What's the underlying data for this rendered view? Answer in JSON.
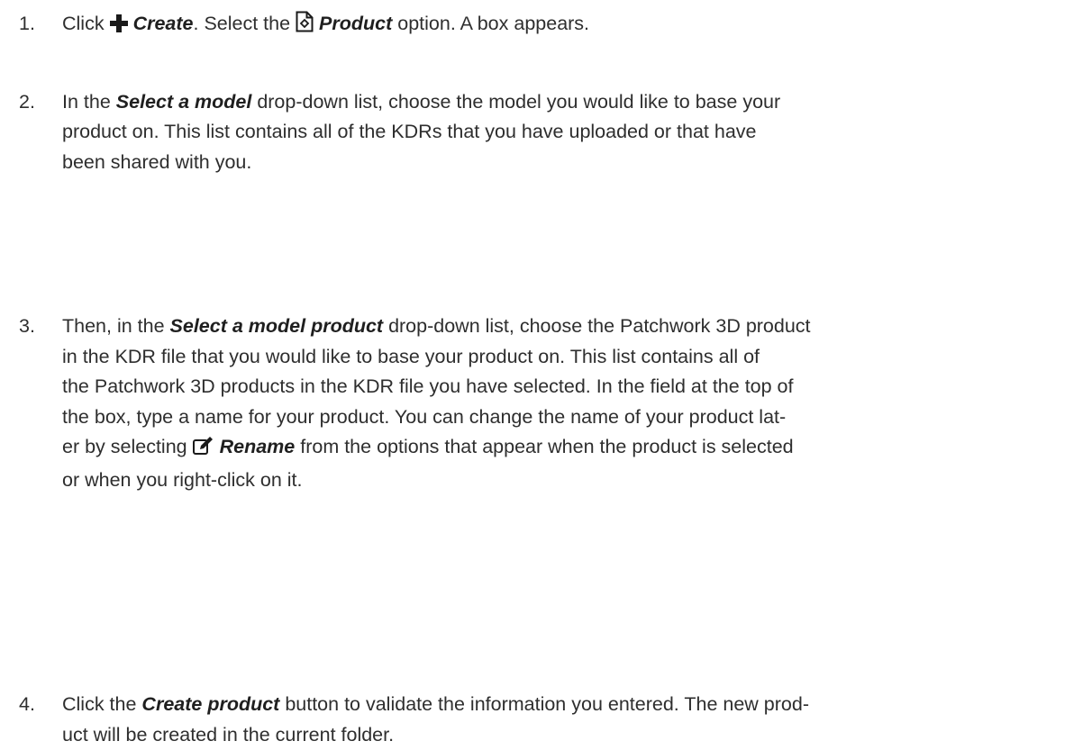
{
  "steps": [
    {
      "number": "1.",
      "parts": [
        "Click ",
        "Create",
        ". Select the ",
        "Product",
        " option. A box appears."
      ],
      "icons": [
        "plus-icon",
        "product-file-icon"
      ]
    },
    {
      "number": "2.",
      "lines": [
        [
          "In the ",
          "Select a model",
          " drop-down list, choose the model you would like to base your"
        ],
        "product on. This list contains all of the KDRs that you have uploaded or that have",
        "been shared with you."
      ]
    },
    {
      "number": "3.",
      "lines": [
        [
          "Then, in the ",
          "Select a model product",
          " drop-down list, choose the Patchwork 3D product"
        ],
        "in the KDR file that you would like to base your product on. This list contains all of",
        "the Patchwork 3D products in the KDR file you have selected. In the field at the top of",
        "the box, type a name for your product. You can change the name of your product lat-",
        [
          "er by selecting ",
          "Rename",
          " from the options that appear when the product is selected"
        ],
        "or when you right-click on it."
      ],
      "icons": [
        "rename-edit-icon"
      ]
    },
    {
      "number": "4.",
      "lines": [
        [
          "Click the ",
          "Create product",
          " button to validate the information you entered. The new prod-"
        ],
        "uct will be created in the current folder."
      ]
    }
  ],
  "colors": {
    "text": "#2e2e2e",
    "emphasis": "#1f1f1f",
    "background": "#ffffff"
  }
}
